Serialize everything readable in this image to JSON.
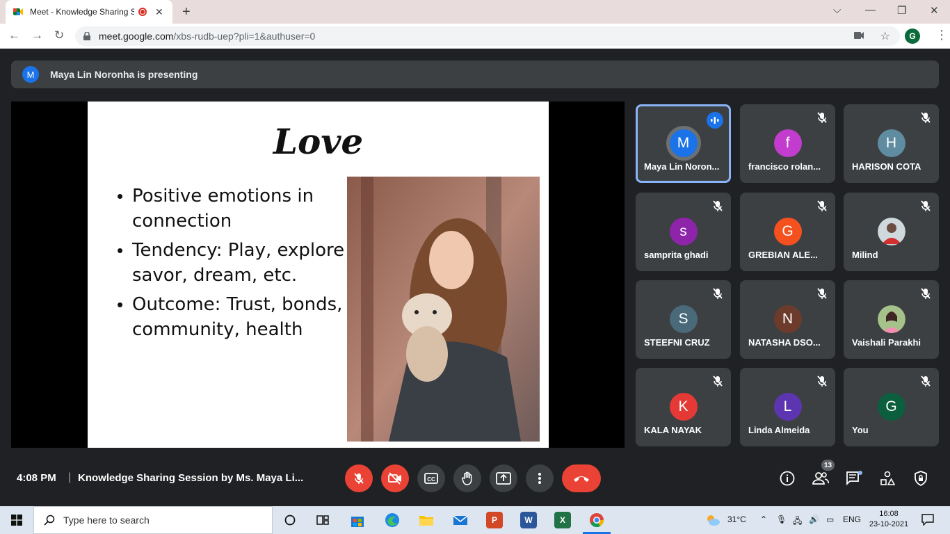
{
  "browser": {
    "tab_title": "Meet - Knowledge Sharing S",
    "url_host": "meet.google.com",
    "url_path": "/xbs-rudb-uep?pli=1&authuser=0",
    "profile_initial": "G"
  },
  "presenting": {
    "avatar_initial": "M",
    "text": "Maya Lin Noronha is presenting"
  },
  "slide": {
    "title": "Love",
    "bullets": [
      "Positive emotions in\nconnection",
      "Tendency: Play, explore\nsavor, dream, etc.",
      "Outcome: Trust, bonds,\ncommunity, health"
    ],
    "bullet_symbol": "•"
  },
  "participants": [
    {
      "name": "Maya Lin Noron...",
      "initial": "M",
      "color": "#1a73e8",
      "speaking": true
    },
    {
      "name": "francisco rolan...",
      "initial": "f",
      "color": "#c23ccd"
    },
    {
      "name": "HARISON COTA",
      "initial": "H",
      "color": "#5f8ca0"
    },
    {
      "name": "samprita ghadi",
      "initial": "s",
      "color": "#8e24aa"
    },
    {
      "name": "GREBIAN ALE...",
      "initial": "G",
      "color": "#f4511e"
    },
    {
      "name": "Milind",
      "initial": "",
      "color": "#d9a6a6",
      "photo": true
    },
    {
      "name": "STEEFNI CRUZ",
      "initial": "S",
      "color": "#4a6a7a"
    },
    {
      "name": "NATASHA DSO...",
      "initial": "N",
      "color": "#6d3b2c"
    },
    {
      "name": "Vaishali Parakhi",
      "initial": "",
      "color": "#d8c8b8",
      "photo": true
    },
    {
      "name": "KALA NAYAK",
      "initial": "K",
      "color": "#e53935"
    },
    {
      "name": "Linda Almeida",
      "initial": "L",
      "color": "#5e35b1"
    },
    {
      "name": "You",
      "initial": "G",
      "color": "#0b5e3e"
    }
  ],
  "bottom_bar": {
    "time": "4:08 PM",
    "separator": "|",
    "meeting_title": "Knowledge Sharing Session by Ms. Maya Li...",
    "participant_count": "13"
  },
  "taskbar": {
    "search_placeholder": "Type here to search",
    "weather": "31°C",
    "language": "ENG",
    "clock_time": "16:08",
    "clock_date": "23-10-2021",
    "word_letter": "W",
    "excel_letter": "X",
    "ppt_letter": "P"
  },
  "colors": {
    "meet_bg": "#202124",
    "tile_bg": "#3c4043",
    "danger": "#ea4335",
    "accent": "#1a73e8",
    "active_border": "#8ab4f8"
  }
}
